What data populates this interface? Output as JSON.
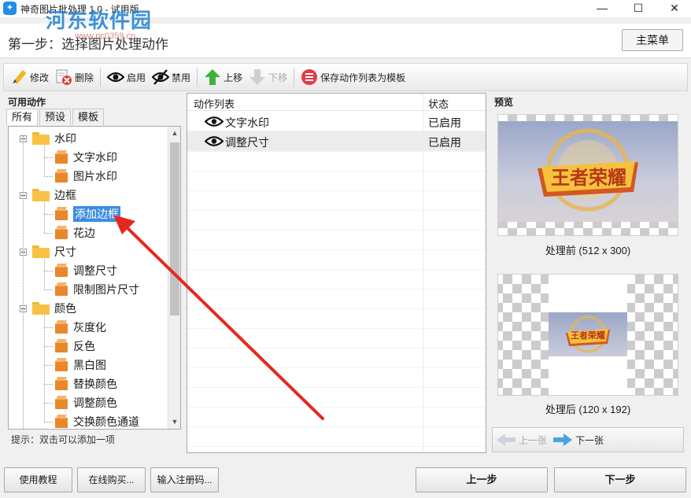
{
  "window": {
    "title": "神奇图片批处理 1.0 - 试用版",
    "watermark": "河东软件园",
    "watermark_url": "www.pc0359.cn",
    "minimize_icon": "minimize-icon",
    "maximize_icon": "maximize-icon",
    "close_icon": "close-icon"
  },
  "step": {
    "title": "第一步：选择图片处理动作",
    "main_menu_label": "主菜单"
  },
  "toolbar": {
    "edit": "修改",
    "delete": "删除",
    "enable": "启用",
    "disable": "禁用",
    "move_up": "上移",
    "move_down": "下移",
    "save_template": "保存动作列表为模板"
  },
  "left": {
    "caption": "可用动作",
    "tabs": [
      "所有",
      "预设",
      "模板"
    ],
    "active_tab": "所有",
    "tree": [
      {
        "label": "水印",
        "type": "folder"
      },
      {
        "label": "文字水印",
        "type": "item"
      },
      {
        "label": "图片水印",
        "type": "item"
      },
      {
        "label": "边框",
        "type": "folder"
      },
      {
        "label": "添加边框",
        "type": "item",
        "selected": true
      },
      {
        "label": "花边",
        "type": "item"
      },
      {
        "label": "尺寸",
        "type": "folder"
      },
      {
        "label": "调整尺寸",
        "type": "item"
      },
      {
        "label": "限制图片尺寸",
        "type": "item"
      },
      {
        "label": "颜色",
        "type": "folder"
      },
      {
        "label": "灰度化",
        "type": "item"
      },
      {
        "label": "反色",
        "type": "item"
      },
      {
        "label": "黑白图",
        "type": "item"
      },
      {
        "label": "替换颜色",
        "type": "item"
      },
      {
        "label": "调整颜色",
        "type": "item"
      },
      {
        "label": "交换颜色通道",
        "type": "item"
      }
    ],
    "hint": "提示：双击可以添加一项"
  },
  "center": {
    "col_action": "动作列表",
    "col_status": "状态",
    "rows": [
      {
        "name": "文字水印",
        "status": "已启用"
      },
      {
        "name": "调整尺寸",
        "status": "已启用"
      }
    ]
  },
  "right": {
    "caption": "预览",
    "before_label": "处理前 (512 x 300)",
    "after_label": "处理后 (120 x 192)",
    "prev_label": "上一张",
    "next_label": "下一张",
    "logo_text": "王者荣耀"
  },
  "bottom": {
    "tutorial": "使用教程",
    "buy": "在线购买...",
    "register": "输入注册码...",
    "prev_step": "上一步",
    "next_step": "下一步"
  },
  "colors": {
    "accent": "#3b8ee0",
    "arrow": "#e5281e",
    "folder": "#f7c244",
    "cube": "#e8882c"
  }
}
